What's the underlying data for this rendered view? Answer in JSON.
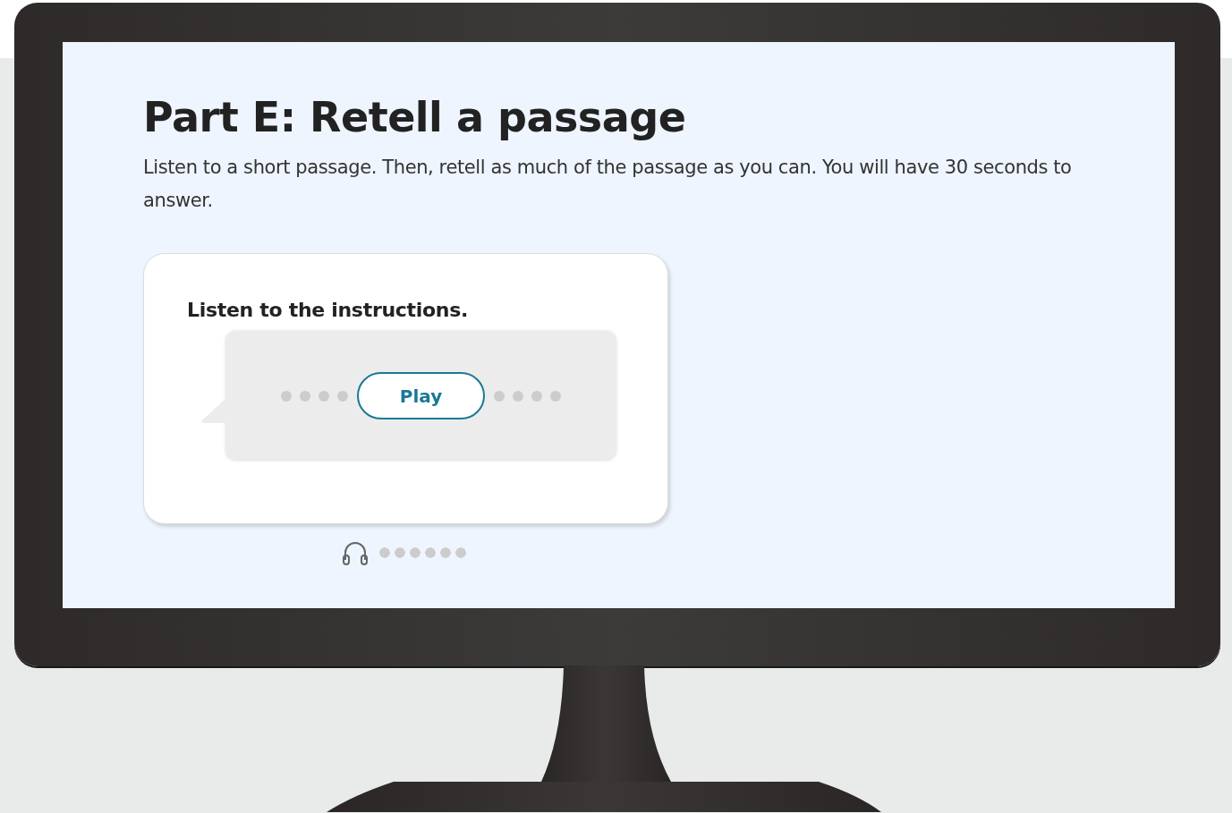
{
  "heading": "Part E: Retell a passage",
  "instructions": "Listen to a short passage. Then, retell as much of the passage as you can. You will have 30 seconds to answer.",
  "card": {
    "title": "Listen to the instructions.",
    "play_button": "Play"
  },
  "volume_meter": {
    "level": 0
  }
}
